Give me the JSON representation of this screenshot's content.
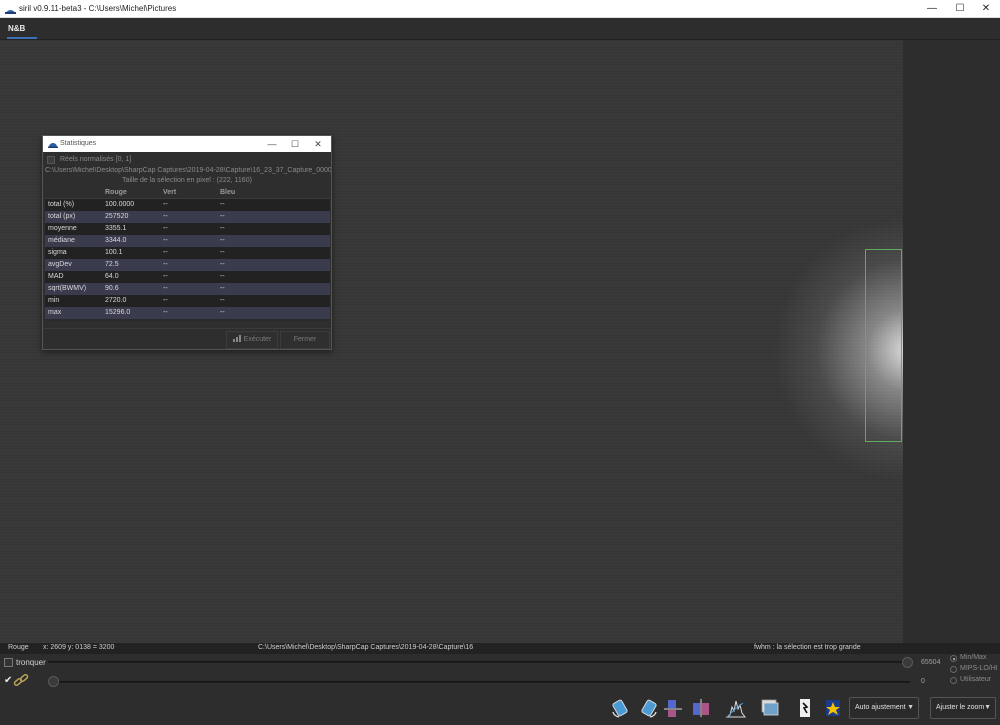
{
  "window": {
    "title": "siril v0.9.11-beta3 - C:\\Users\\Michel\\Pictures",
    "minimize": "—",
    "maximize": "☐",
    "close": "✕"
  },
  "tabs": [
    {
      "label": "N&B",
      "active": true
    }
  ],
  "dialog": {
    "title": "Statistiques",
    "checkbox_label": "Réels normalisés [0, 1]",
    "file_path": "C:\\Users\\Michel\\Desktop\\SharpCap Captures\\2019-04-28\\Capture\\16_23_37_Capture_00001.fits",
    "selection_size": "Taille de la sélection en pixel : (222, 1160)",
    "columns": [
      "",
      "Rouge",
      "Vert",
      "Bleu"
    ],
    "rows": [
      [
        "total (%)",
        "100.0000",
        "--",
        "--"
      ],
      [
        "total (px)",
        "257520",
        "--",
        "--"
      ],
      [
        "moyenne",
        "3355.1",
        "--",
        "--"
      ],
      [
        "médiane",
        "3344.0",
        "--",
        "--"
      ],
      [
        "sigma",
        "100.1",
        "--",
        "--"
      ],
      [
        "avgDev",
        "72.5",
        "--",
        "--"
      ],
      [
        "MAD",
        "64.0",
        "--",
        "--"
      ],
      [
        "sqrt(BWMV)",
        "90.6",
        "--",
        "--"
      ],
      [
        "min",
        "2720.0",
        "--",
        "--"
      ],
      [
        "max",
        "15296.0",
        "--",
        "--"
      ]
    ],
    "execute_label": "Exécuter",
    "close_label": "Fermer"
  },
  "statusbar": {
    "channel": "Rouge",
    "coords": "x: 2609 y: 0138 = 3200",
    "path": "C:\\Users\\Michel\\Desktop\\SharpCap Captures\\2019-04-28\\Capture\\16",
    "message": "fwhm : la sélection est trop grande"
  },
  "controls": {
    "tronquer_label": "tronquer",
    "max_value": "65504",
    "min_value": "0",
    "radio_options": [
      {
        "label": "Min/Max",
        "selected": true
      },
      {
        "label": "MIPS-LO/HI",
        "selected": false
      },
      {
        "label": "Utilisateur",
        "selected": false
      }
    ],
    "scale_dropdown": "Auto ajustement",
    "zoom_dropdown": "Ajuster le zoom"
  },
  "colors": {
    "accent": "#3f6fb5",
    "selection": "#5fae5f",
    "row_alt": "#3b3b4e"
  },
  "icons": [
    "siril-app-icon",
    "rotate-left-icon",
    "rotate-right-icon",
    "mirror-x-icon",
    "mirror-y-icon",
    "histogram-icon",
    "image-stack-icon",
    "negative-icon",
    "false-color-icon"
  ]
}
